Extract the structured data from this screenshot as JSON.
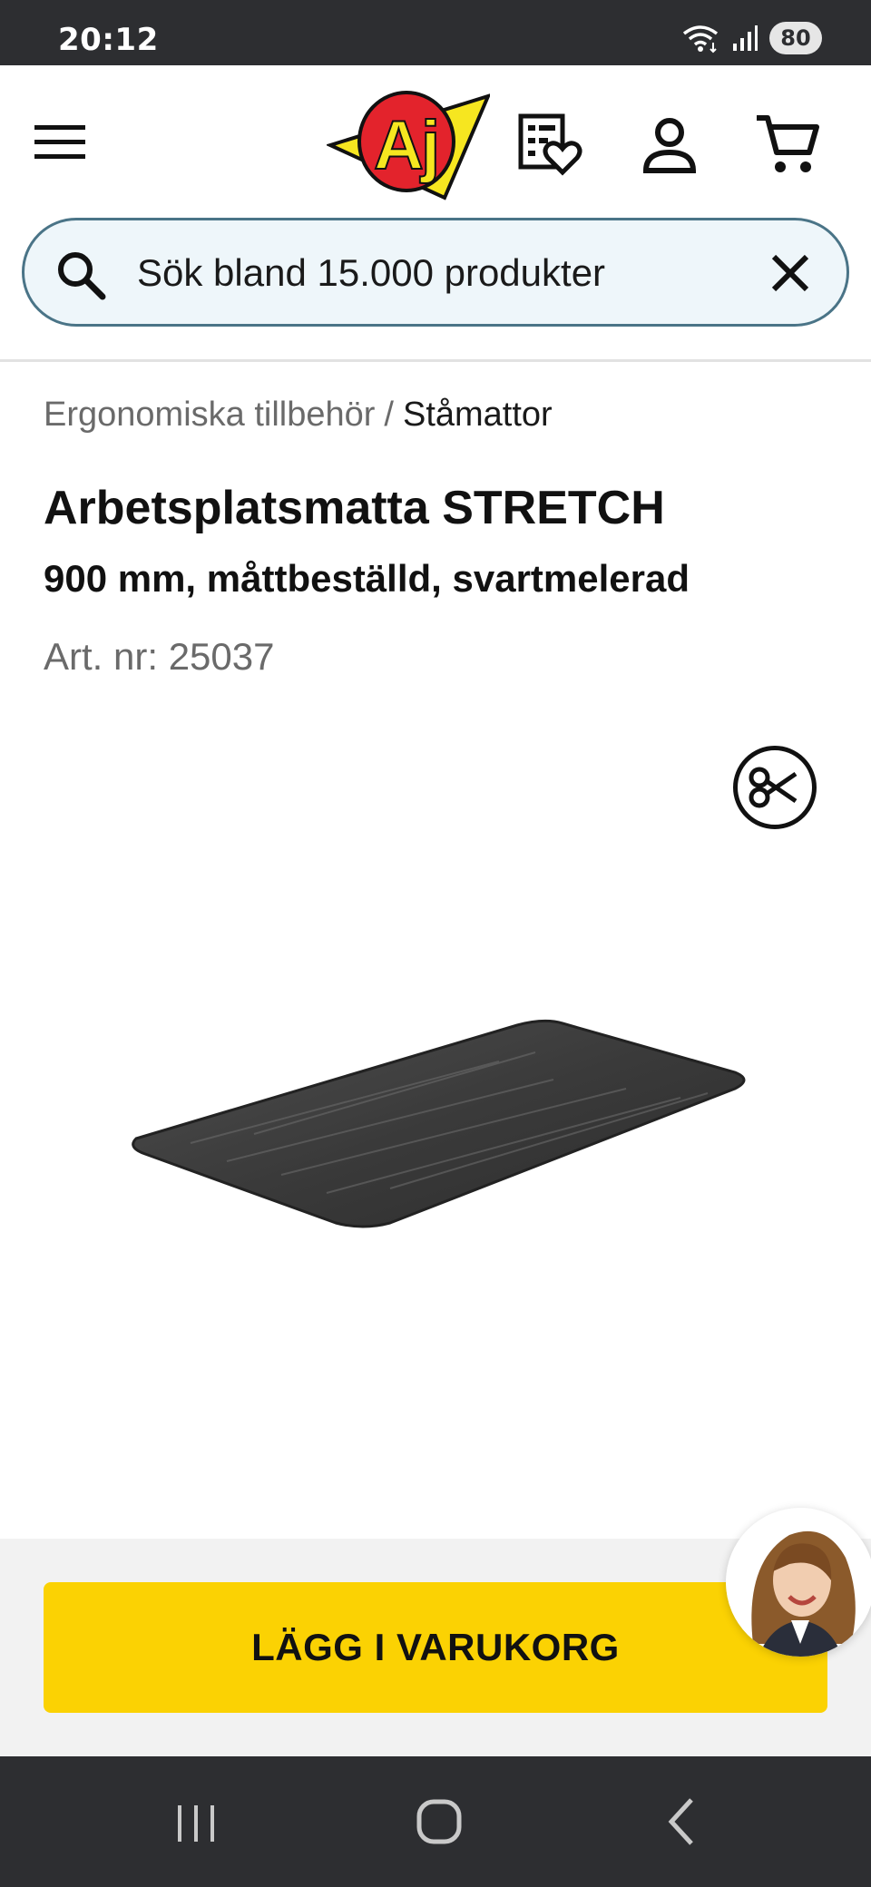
{
  "status_bar": {
    "time": "20:12",
    "battery": "80",
    "icons": [
      "wifi-icon",
      "signal-icon"
    ]
  },
  "header": {
    "logo_text": "AJ",
    "icons": [
      "menu-icon",
      "wishlist-icon",
      "account-icon",
      "cart-icon"
    ]
  },
  "search": {
    "placeholder": "Sök bland 15.000 produkter"
  },
  "breadcrumb": {
    "parent": "Ergonomiska tillbehör",
    "separator": "/",
    "current": "Ståmattor"
  },
  "product": {
    "title": "Arbetsplatsmatta STRETCH",
    "subtitle": "900 mm, måttbeställd, svartmelerad",
    "art_nr": "Art. nr: 25037"
  },
  "actions": {
    "add_to_cart": "LÄGG I VARUKORG"
  },
  "colors": {
    "accent_yellow": "#fbd203",
    "logo_red": "#e3232c",
    "search_border": "#4a7487",
    "search_bg": "#eef6fa",
    "system_bar": "#2d2e31"
  }
}
